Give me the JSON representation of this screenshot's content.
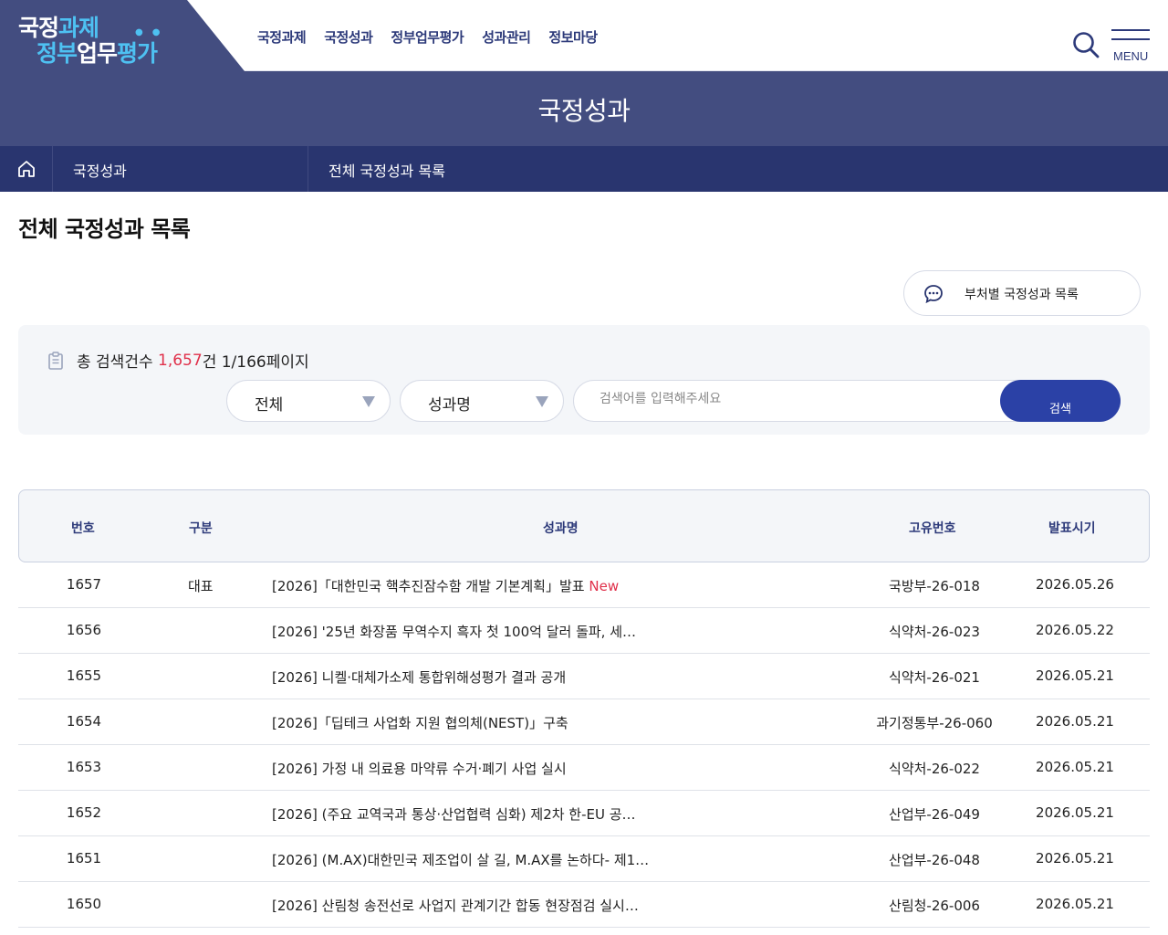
{
  "logo": {
    "line1_a": "국정",
    "line1_b": "과제",
    "line2_a": "정부",
    "line2_b": "업무",
    "line2_c": "평가"
  },
  "gnb": [
    "국정과제",
    "국정성과",
    "정부업무평가",
    "성과관리",
    "정보마당"
  ],
  "menu": {
    "label": "MENU"
  },
  "banner": {
    "title": "국정성과"
  },
  "breadcrumb": {
    "level1": "국정성과",
    "level2": "전체 국정성과 목록"
  },
  "page_title": "전체 국정성과 목록",
  "dept_button": {
    "label": "부처별 국정성과 목록"
  },
  "search": {
    "count_prefix": "총 검색건수 ",
    "count_value": "1,657",
    "count_suffix": "건 1/166페이지",
    "select1": "전체",
    "select2": "성과명",
    "placeholder": "검색어를 입력해주세요",
    "button": "검색"
  },
  "table": {
    "headers": [
      "번호",
      "구분",
      "성과명",
      "고유번호",
      "발표시기"
    ],
    "rows": [
      {
        "num": "1657",
        "cat": "대표",
        "title": "[2026]「대한민국 핵추진잠수함 개발 기본계획」발표",
        "new": "New",
        "code": "국방부-26-018",
        "date": "2026.05.26"
      },
      {
        "num": "1656",
        "cat": "",
        "title": "[2026] '25년 화장품 무역수지 흑자 첫 100억 달러 돌파, 세…",
        "new": "",
        "code": "식약처-26-023",
        "date": "2026.05.22"
      },
      {
        "num": "1655",
        "cat": "",
        "title": "[2026] 니켈·대체가소제 통합위해성평가 결과 공개",
        "new": "",
        "code": "식약처-26-021",
        "date": "2026.05.21"
      },
      {
        "num": "1654",
        "cat": "",
        "title": "[2026]「딥테크 사업화 지원 협의체(NEST)」구축",
        "new": "",
        "code": "과기정통부-26-060",
        "date": "2026.05.21"
      },
      {
        "num": "1653",
        "cat": "",
        "title": "[2026] 가정 내 의료용 마약류 수거·폐기 사업 실시",
        "new": "",
        "code": "식약처-26-022",
        "date": "2026.05.21"
      },
      {
        "num": "1652",
        "cat": "",
        "title": "[2026] (주요 교역국과 통상·산업협력 심화) 제2차 한-EU 공…",
        "new": "",
        "code": "산업부-26-049",
        "date": "2026.05.21"
      },
      {
        "num": "1651",
        "cat": "",
        "title": "[2026] (M.AX)대한민국 제조업이 살 길, M.AX를 논하다- 제1…",
        "new": "",
        "code": "산업부-26-048",
        "date": "2026.05.21"
      },
      {
        "num": "1650",
        "cat": "",
        "title": "[2026] 산림청 송전선로 사업지 관계기간 합동 현장점검 실시…",
        "new": "",
        "code": "산림청-26-006",
        "date": "2026.05.21"
      }
    ]
  },
  "colors": {
    "navy": "#434d80",
    "dark_navy": "#29356f",
    "accent_blue": "#2b41a6",
    "logo_cyan": "#4ec1f2",
    "highlight_red": "#e0304a"
  }
}
